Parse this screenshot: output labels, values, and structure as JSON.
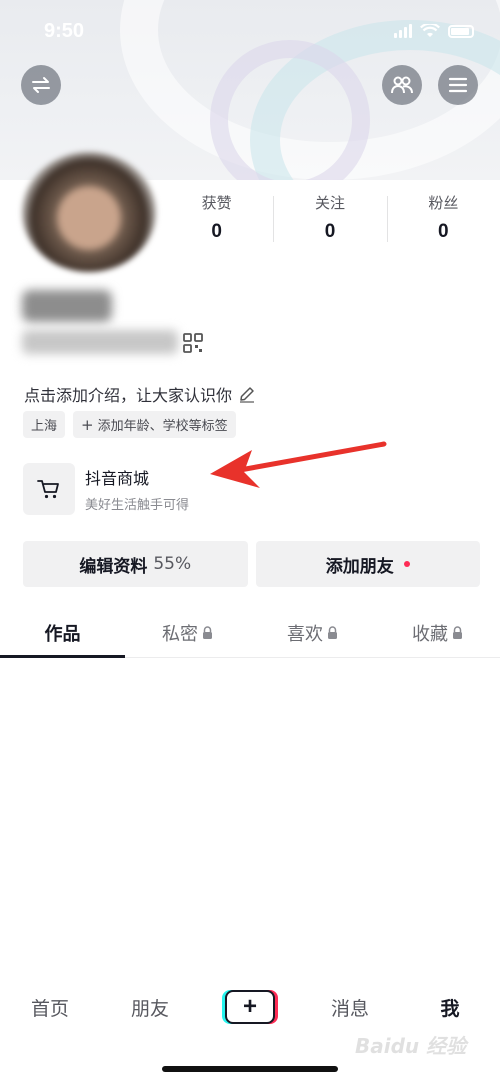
{
  "status_bar": {
    "time": "9:50"
  },
  "stats": [
    {
      "label": "获赞",
      "value": "0"
    },
    {
      "label": "关注",
      "value": "0"
    },
    {
      "label": "粉丝",
      "value": "0"
    }
  ],
  "bio": {
    "text": "点击添加介绍，让大家认识你"
  },
  "tags": {
    "location": "上海",
    "add": "添加年龄、学校等标签"
  },
  "shop": {
    "title": "抖音商城",
    "subtitle": "美好生活触手可得"
  },
  "actions": {
    "edit_label": "编辑资料",
    "edit_percent": "55%",
    "add_friend": "添加朋友"
  },
  "tabs": [
    "作品",
    "私密",
    "喜欢",
    "收藏"
  ],
  "bottom_nav": {
    "home": "首页",
    "friends": "朋友",
    "plus": "+",
    "messages": "消息",
    "me": "我"
  },
  "watermark": "Baidu 经验",
  "colors": {
    "accent_red": "#fe2c55",
    "accent_cyan": "#25f4ee",
    "arrow": "#e8322b"
  },
  "icons": [
    "switch-account-icon",
    "friends-icon",
    "menu-icon",
    "qr-code-icon",
    "edit-pencil-icon",
    "cart-icon",
    "lock-icon"
  ]
}
